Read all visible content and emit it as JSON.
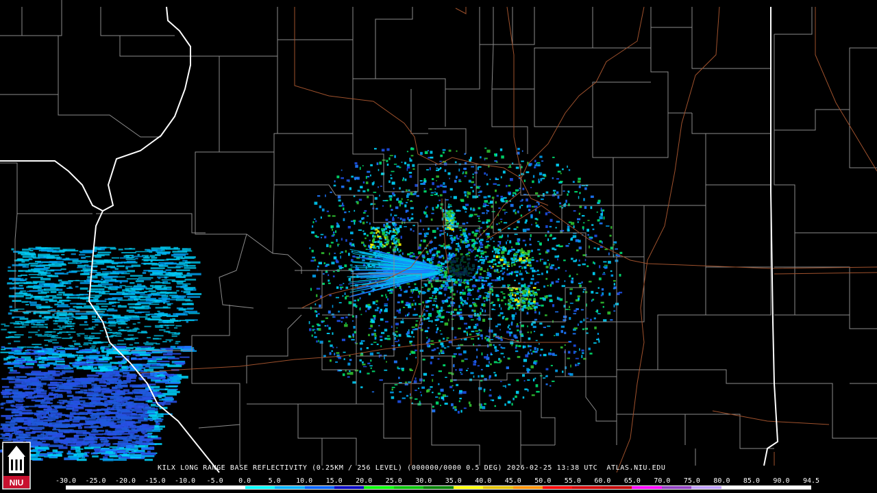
{
  "product": {
    "label": "KILX LONG RANGE BASE REFLECTIVITY (0.25KM / 256 LEVEL) (000000/0000 0.5 DEG) 2026-02-25 13:38 UTC  ATLAS.NIU.EDU"
  },
  "scale": {
    "ticks": [
      "-30.0",
      "-25.0",
      "-20.0",
      "-15.0",
      "-10.0",
      "-5.0",
      "0.0",
      "5.0",
      "10.0",
      "15.0",
      "20.0",
      "25.0",
      "30.0",
      "35.0",
      "40.0",
      "45.0",
      "50.0",
      "55.0",
      "60.0",
      "65.0",
      "70.0",
      "75.0",
      "80.0",
      "85.0",
      "90.0",
      "94.5"
    ],
    "colors": [
      "#ffffff",
      "#ffffff",
      "#ffffff",
      "#ffffff",
      "#ffffff",
      "#ffffff",
      "#00ffff",
      "#00b0ff",
      "#0060ff",
      "#0000c0",
      "#00ff00",
      "#00c000",
      "#008000",
      "#ffff00",
      "#e0c000",
      "#ff9000",
      "#ff0000",
      "#d00000",
      "#c00000",
      "#ff00ff",
      "#9040c0",
      "#c0a0ff",
      "#ffffff",
      "#ffffff",
      "#ffffff"
    ]
  },
  "map": {
    "colors": {
      "county_lines": "#8c8c8c",
      "state_lines": "#ffffff",
      "highways": "#a0522d",
      "background": "#000000"
    }
  },
  "logo": {
    "text": "NIU",
    "color": "#c8102e"
  }
}
